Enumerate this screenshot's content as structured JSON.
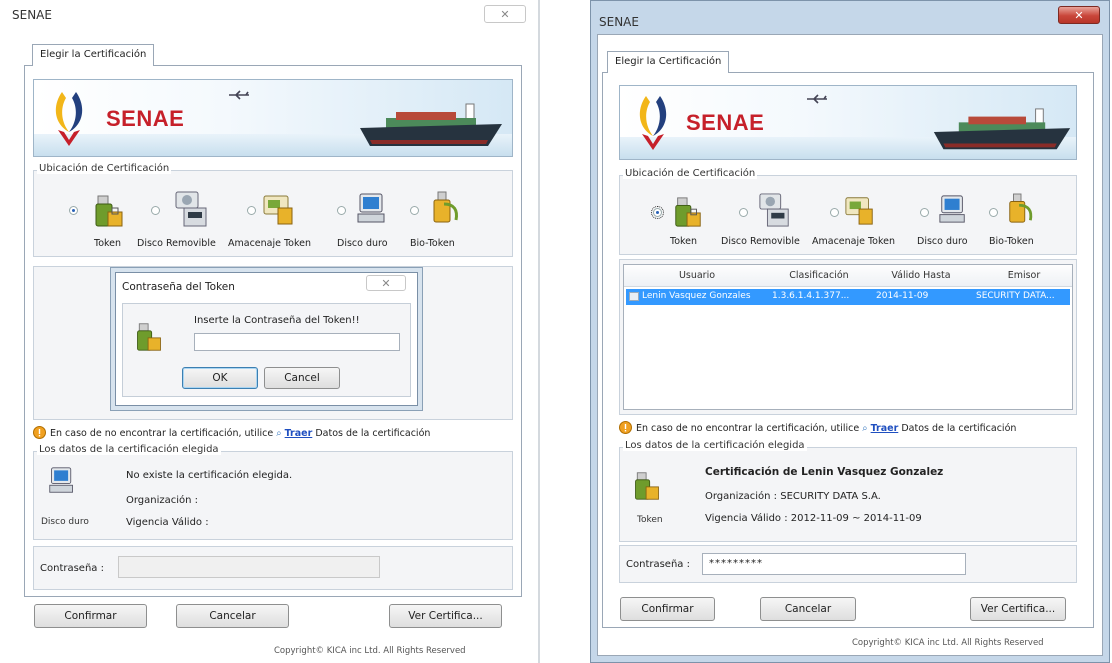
{
  "left": {
    "window_title": "SENAE",
    "tab_label": "Elegir la Certificación",
    "banner_brand": "SENAE",
    "location_group_label": "Ubicación de Certificación",
    "location_options": [
      "Token",
      "Disco Removible",
      "Amacenaje Token",
      "Disco duro",
      "Bio-Token"
    ],
    "selected_location": "Token",
    "password_dialog": {
      "title": "Contraseña del Token",
      "message": "Inserte la Contraseña del Token!!",
      "ok_label": "OK",
      "cancel_label": "Cancel",
      "password_value": ""
    },
    "info_line": {
      "prefix": "En caso de no encontrar la certificación, utilice",
      "link": "Traer",
      "suffix": "Datos de la certificación"
    },
    "selected_group_label": "Los datos de la certificación elegida",
    "cert_icon_caption": "Disco duro",
    "cert_title": "No existe la certificación elegida.",
    "organization_label": "Organización :",
    "organization_value": "",
    "validity_label": "Vigencia Válido :",
    "validity_value": "",
    "password_label": "Contraseña :",
    "password_value": "",
    "buttons": {
      "confirm": "Confirmar",
      "cancel": "Cancelar",
      "view_cert": "Ver Certifica..."
    },
    "copyright": "Copyright© KICA inc Ltd. All Rights Reserved"
  },
  "right": {
    "window_title": "SENAE",
    "tab_label": "Elegir la Certificación",
    "banner_brand": "SENAE",
    "location_group_label": "Ubicación de Certificación",
    "location_options": [
      "Token",
      "Disco Removible",
      "Amacenaje Token",
      "Disco duro",
      "Bio-Token"
    ],
    "selected_location": "Token",
    "cert_table": {
      "columns": [
        "Usuario",
        "Clasificación",
        "Válido Hasta",
        "Emisor"
      ],
      "rows": [
        [
          "Lenin Vasquez Gonzales",
          "1.3.6.1.4.1.377...",
          "2014-11-09",
          "SECURITY DATA..."
        ]
      ]
    },
    "info_line": {
      "prefix": "En caso de no encontrar la certificación, utilice",
      "link": "Traer",
      "suffix": "Datos de la certificación"
    },
    "selected_group_label": "Los datos de la certificación elegida",
    "cert_icon_caption": "Token",
    "cert_title": "Certificación de Lenin Vasquez Gonzalez",
    "organization_label": "Organización :",
    "organization_value": "SECURITY DATA S.A.",
    "validity_label": "Vigencia Válido :",
    "validity_value": "2012-11-09 ~ 2014-11-09",
    "password_label": "Contraseña :",
    "password_value": "*********",
    "buttons": {
      "confirm": "Confirmar",
      "cancel": "Cancelar",
      "view_cert": "Ver Certifica..."
    },
    "copyright": "Copyright© KICA inc Ltd. All Rights Reserved"
  },
  "colors": {
    "brand_red": "#c6202a",
    "selection_blue": "#3399ff",
    "link_blue": "#1f4fc0",
    "close_red": "#c9463a"
  },
  "icons": [
    "usb-token-icon",
    "removable-disk-icon",
    "token-storage-icon",
    "hard-disk-computer-icon",
    "bio-token-icon",
    "info-icon",
    "search-icon",
    "airplane-icon",
    "cargo-ship-icon",
    "senae-logo-icon"
  ]
}
